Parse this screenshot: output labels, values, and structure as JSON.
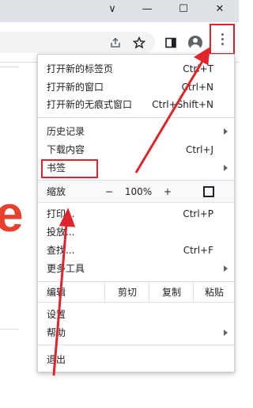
{
  "window": {
    "controls": [
      "chevron-down-icon",
      "minimize-icon",
      "maximize-icon",
      "close-icon"
    ],
    "chevron_glyph": "∨",
    "minimize_glyph": "—",
    "maximize_glyph": "☐",
    "close_glyph": "✕"
  },
  "toolbar": {
    "icons": [
      "share-icon",
      "star-icon",
      "side-panel-icon",
      "profile-avatar-icon",
      "more-menu-icon"
    ]
  },
  "page": {
    "partial_letter": "e"
  },
  "menu": {
    "items": [
      {
        "label": "打开新的标签页",
        "shortcut": "Ctrl+T"
      },
      {
        "label": "打开新的窗口",
        "shortcut": "Ctrl+N"
      },
      {
        "label": "打开新的无痕式窗口",
        "shortcut": "Ctrl+Shift+N"
      },
      {
        "label": "历史记录",
        "shortcut": ""
      },
      {
        "label": "下载内容",
        "shortcut": "Ctrl+J"
      },
      {
        "label": "书签",
        "shortcut": ""
      },
      {
        "label": "打印...",
        "shortcut": "Ctrl+P"
      },
      {
        "label": "投放...",
        "shortcut": ""
      },
      {
        "label": "查找...",
        "shortcut": "Ctrl+F"
      },
      {
        "label": "更多工具",
        "shortcut": ""
      },
      {
        "label": "设置",
        "shortcut": ""
      },
      {
        "label": "帮助",
        "shortcut": ""
      },
      {
        "label": "退出",
        "shortcut": ""
      }
    ],
    "zoom": {
      "label": "缩放",
      "minus": "−",
      "value": "100%",
      "plus": "+"
    },
    "edit": {
      "label": "编辑",
      "cut": "剪切",
      "copy": "复制",
      "paste": "粘贴"
    }
  },
  "annotation_color": "#e0242b"
}
